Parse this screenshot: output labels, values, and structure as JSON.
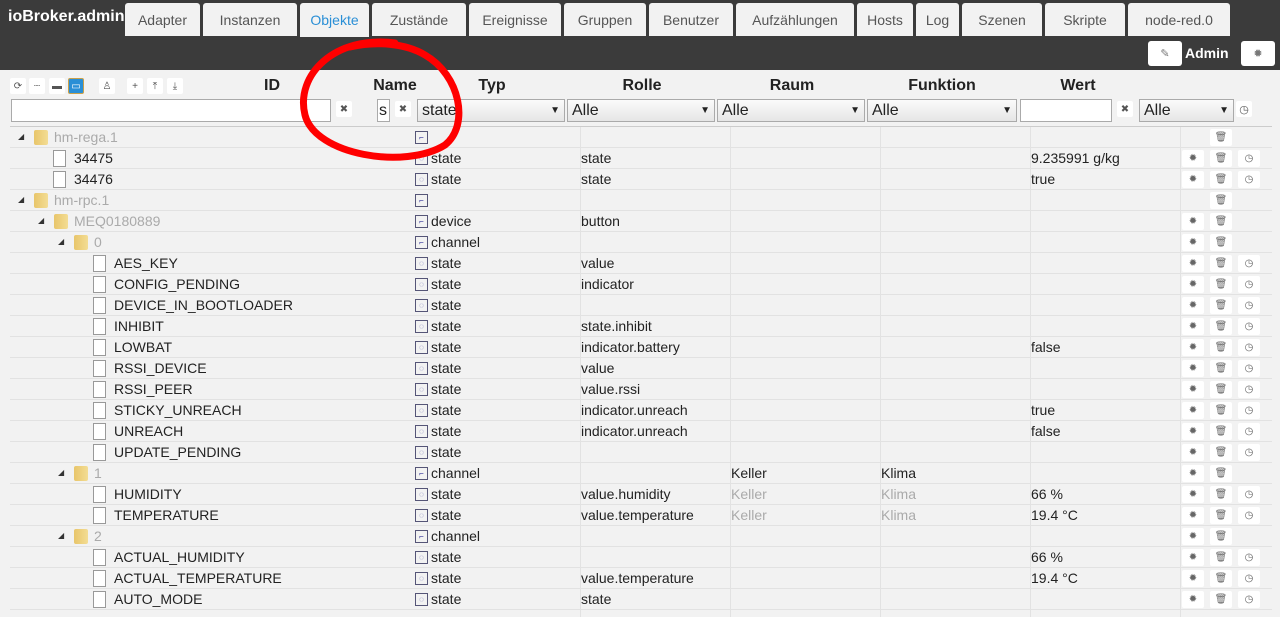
{
  "app_title": "ioBroker.admin",
  "tabs": [
    {
      "label": "Adapter"
    },
    {
      "label": "Instanzen"
    },
    {
      "label": "Objekte",
      "active": true
    },
    {
      "label": "Zustände"
    },
    {
      "label": "Ereignisse"
    },
    {
      "label": "Gruppen"
    },
    {
      "label": "Benutzer"
    },
    {
      "label": "Aufzählungen"
    },
    {
      "label": "Hosts"
    },
    {
      "label": "Log"
    },
    {
      "label": "Szenen"
    },
    {
      "label": "Skripte"
    },
    {
      "label": "node-red.0"
    }
  ],
  "user": "Admin",
  "columns": {
    "id": "ID",
    "name": "Name",
    "type": "Typ",
    "role": "Rolle",
    "room": "Raum",
    "function": "Funktion",
    "value": "Wert"
  },
  "filters": {
    "id": "",
    "name": "s",
    "type": "state",
    "role": "Alle",
    "room": "Alle",
    "function": "Alle",
    "value": "",
    "value_select": "Alle"
  },
  "accent": "#2a8fd6",
  "annotation_color": "#ff0000",
  "rows": [
    {
      "level": 0,
      "folder": true,
      "name": "hm-rega.1",
      "muted": true,
      "typeicon": "meta",
      "type": "",
      "role": "",
      "room": "",
      "function": "",
      "value": "",
      "buttons": [
        "trash"
      ]
    },
    {
      "level": 1,
      "name": "34475",
      "type": "state",
      "role": "state",
      "room": "",
      "function": "",
      "value": "9.235991 g/kg",
      "buttons": [
        "gear",
        "trash",
        "clock"
      ]
    },
    {
      "level": 1,
      "name": "34476",
      "type": "state",
      "role": "state",
      "room": "",
      "function": "",
      "value": "true",
      "buttons": [
        "gear",
        "trash",
        "clock"
      ]
    },
    {
      "level": 0,
      "folder": true,
      "name": "hm-rpc.1",
      "muted": true,
      "typeicon": "meta",
      "type": "",
      "role": "",
      "room": "",
      "function": "",
      "value": "",
      "buttons": [
        "trash"
      ]
    },
    {
      "level": 1,
      "folder": true,
      "name": "MEQ0180889",
      "muted": true,
      "type": "device",
      "role": "button",
      "room": "",
      "function": "",
      "value": "",
      "buttons": [
        "gear",
        "trash"
      ]
    },
    {
      "level": 2,
      "folder": true,
      "name": "0",
      "muted": true,
      "type": "channel",
      "role": "",
      "room": "",
      "function": "",
      "value": "",
      "buttons": [
        "gear",
        "trash"
      ]
    },
    {
      "level": 3,
      "name": "AES_KEY",
      "type": "state",
      "role": "value",
      "room": "",
      "function": "",
      "value": "",
      "buttons": [
        "gear",
        "trash",
        "clock"
      ]
    },
    {
      "level": 3,
      "name": "CONFIG_PENDING",
      "type": "state",
      "role": "indicator",
      "room": "",
      "function": "",
      "value": "",
      "buttons": [
        "gear",
        "trash",
        "clock"
      ]
    },
    {
      "level": 3,
      "name": "DEVICE_IN_BOOTLOADER",
      "type": "state",
      "role": "",
      "room": "",
      "function": "",
      "value": "",
      "buttons": [
        "gear",
        "trash",
        "clock"
      ]
    },
    {
      "level": 3,
      "name": "INHIBIT",
      "type": "state",
      "role": "state.inhibit",
      "room": "",
      "function": "",
      "value": "",
      "buttons": [
        "gear",
        "trash",
        "clock"
      ]
    },
    {
      "level": 3,
      "name": "LOWBAT",
      "type": "state",
      "role": "indicator.battery",
      "room": "",
      "function": "",
      "value": "false",
      "buttons": [
        "gear",
        "trash",
        "clock"
      ]
    },
    {
      "level": 3,
      "name": "RSSI_DEVICE",
      "type": "state",
      "role": "value",
      "room": "",
      "function": "",
      "value": "",
      "buttons": [
        "gear",
        "trash",
        "clock"
      ]
    },
    {
      "level": 3,
      "name": "RSSI_PEER",
      "type": "state",
      "role": "value.rssi",
      "room": "",
      "function": "",
      "value": "",
      "buttons": [
        "gear",
        "trash",
        "clock"
      ]
    },
    {
      "level": 3,
      "name": "STICKY_UNREACH",
      "type": "state",
      "role": "indicator.unreach",
      "room": "",
      "function": "",
      "value": "true",
      "buttons": [
        "gear",
        "trash",
        "clock"
      ]
    },
    {
      "level": 3,
      "name": "UNREACH",
      "type": "state",
      "role": "indicator.unreach",
      "room": "",
      "function": "",
      "value": "false",
      "buttons": [
        "gear",
        "trash",
        "clock"
      ]
    },
    {
      "level": 3,
      "name": "UPDATE_PENDING",
      "type": "state",
      "role": "",
      "room": "",
      "function": "",
      "value": "",
      "buttons": [
        "gear",
        "trash",
        "clock"
      ]
    },
    {
      "level": 2,
      "folder": true,
      "name": "1",
      "muted": true,
      "type": "channel",
      "role": "",
      "room": "Keller",
      "function": "Klima",
      "value": "",
      "buttons": [
        "gear",
        "trash"
      ]
    },
    {
      "level": 3,
      "name": "HUMIDITY",
      "type": "state",
      "role": "value.humidity",
      "room": "Keller",
      "function": "Klima",
      "inherited": true,
      "value": "66 %",
      "buttons": [
        "gear",
        "trash",
        "clock"
      ]
    },
    {
      "level": 3,
      "name": "TEMPERATURE",
      "type": "state",
      "role": "value.temperature",
      "room": "Keller",
      "function": "Klima",
      "inherited": true,
      "value": "19.4 °C",
      "buttons": [
        "gear",
        "trash",
        "clock"
      ]
    },
    {
      "level": 2,
      "folder": true,
      "name": "2",
      "muted": true,
      "type": "channel",
      "role": "",
      "room": "",
      "function": "",
      "value": "",
      "buttons": [
        "gear",
        "trash"
      ]
    },
    {
      "level": 3,
      "name": "ACTUAL_HUMIDITY",
      "type": "state",
      "role": "",
      "room": "",
      "function": "",
      "value": "66 %",
      "buttons": [
        "gear",
        "trash",
        "clock"
      ]
    },
    {
      "level": 3,
      "name": "ACTUAL_TEMPERATURE",
      "type": "state",
      "role": "value.temperature",
      "room": "",
      "function": "",
      "value": "19.4 °C",
      "buttons": [
        "gear",
        "trash",
        "clock"
      ]
    },
    {
      "level": 3,
      "name": "AUTO_MODE",
      "type": "state",
      "role": "state",
      "room": "",
      "function": "",
      "value": "",
      "buttons": [
        "gear",
        "trash",
        "clock"
      ]
    }
  ]
}
